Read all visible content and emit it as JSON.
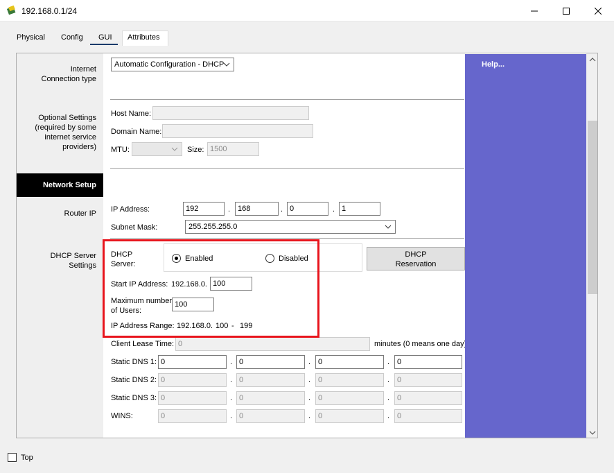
{
  "window": {
    "title": "192.168.0.1/24",
    "minimize": "–",
    "maximize": "□",
    "close": "✕",
    "app_icon": "network-device-icon"
  },
  "tabs": [
    {
      "label": "Physical"
    },
    {
      "label": "Config"
    },
    {
      "label": "GUI",
      "active": true
    },
    {
      "label": "Attributes"
    }
  ],
  "sections": {
    "internet_connection_type": "Internet\nConnection type",
    "optional_settings": "Optional Settings\n(required by some\ninternet service\nproviders)",
    "network_setup": "Network Setup",
    "router_ip": "Router IP",
    "dhcp_server_settings": "DHCP Server\nSettings"
  },
  "connection_type": {
    "value": "Automatic Configuration - DHCP"
  },
  "optional": {
    "host_name_label": "Host Name:",
    "host_name_value": "",
    "domain_name_label": "Domain Name:",
    "domain_name_value": "",
    "mtu_label": "MTU:",
    "mtu_value": "",
    "size_label": "Size:",
    "size_value": "1500"
  },
  "router_ip": {
    "ip_label": "IP Address:",
    "ip_octets": [
      "192",
      "168",
      "0",
      "1"
    ],
    "subnet_label": "Subnet Mask:",
    "subnet_value": "255.255.255.0"
  },
  "dhcp": {
    "server_label": "DHCP\nServer:",
    "enabled_label": "Enabled",
    "disabled_label": "Disabled",
    "selected": "enabled",
    "reservation_button": "DHCP\nReservation",
    "start_ip_label": "Start IP Address:",
    "start_ip_prefix": "192.168.0.",
    "start_ip_value": "100",
    "max_users_label": "Maximum number\nof Users:",
    "max_users_value": "100",
    "range_label": "IP Address Range:",
    "range_prefix": "192.168.0.",
    "range_start": "100",
    "range_sep": "-",
    "range_end": "199",
    "lease_label": "Client Lease Time:",
    "lease_value": "0",
    "lease_suffix": "minutes (0 means one day)",
    "dns1_label": "Static DNS 1:",
    "dns1": [
      "0",
      "0",
      "0",
      "0"
    ],
    "dns2_label": "Static DNS 2:",
    "dns2": [
      "0",
      "0",
      "0",
      "0"
    ],
    "dns3_label": "Static DNS 3:",
    "dns3": [
      "0",
      "0",
      "0",
      "0"
    ],
    "wins_label": "WINS:",
    "wins": [
      "0",
      "0",
      "0",
      "0"
    ]
  },
  "help": {
    "label": "Help..."
  },
  "footer": {
    "top_label": "Top",
    "top_checked": false
  },
  "colors": {
    "help_panel": "#6666cc",
    "highlight": "#e8141c",
    "network_setup_bar": "#000000"
  }
}
